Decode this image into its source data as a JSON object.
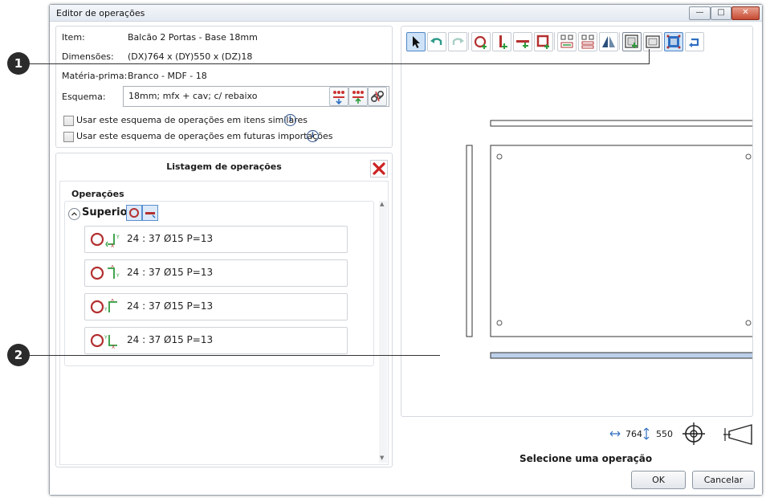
{
  "window": {
    "title": "Editor de operações",
    "min_glyph": "—",
    "max_glyph": "□",
    "close_glyph": "✕"
  },
  "item_info": {
    "item_label": "Item:",
    "item_value": "Balcão 2 Portas - Base 18mm",
    "dims_label": "Dimensões:",
    "dims_value": "(DX)764 x (DY)550 x (DZ)18",
    "material_label": "Matéria-prima:",
    "material_value": "Branco - MDF - 18",
    "schema_label": "Esquema:",
    "schema_value": "18mm; mfx + cav; c/ rebaixo",
    "check_similar": "Usar este esquema de operações em itens similares",
    "check_future": "Usar este esquema de operações em futuras importações",
    "info_glyph": "i"
  },
  "operations": {
    "header": "Listagem de operações",
    "group_label": "Operações",
    "face": "Superior",
    "items": [
      {
        "text": "24 : 37 Ø15 P=13"
      },
      {
        "text": "24 : 37 Ø15 P=13"
      },
      {
        "text": "24 : 37 Ø15 P=13"
      },
      {
        "text": "24 : 37 Ø15 P=13"
      }
    ]
  },
  "toolbar": {
    "tools": [
      "select-arrow",
      "undo",
      "redo",
      "add-hole",
      "add-vertical-line",
      "add-horizontal-line",
      "add-rectangle",
      "grid-a",
      "grid-b",
      "mirror",
      "frame-add",
      "frame-view",
      "frame-select",
      "rotate"
    ]
  },
  "preview": {
    "dim_x": "764",
    "dim_y": "550",
    "status": "Selecione uma operação"
  },
  "callouts": [
    "1",
    "2"
  ],
  "buttons": {
    "ok": "OK",
    "cancel": "Cancelar"
  },
  "colors": {
    "accent_blue": "#2f6fc1",
    "hole_red": "#b33030",
    "arrow_green": "#2e9b3c",
    "selected_edge": "#bcd0ea"
  }
}
